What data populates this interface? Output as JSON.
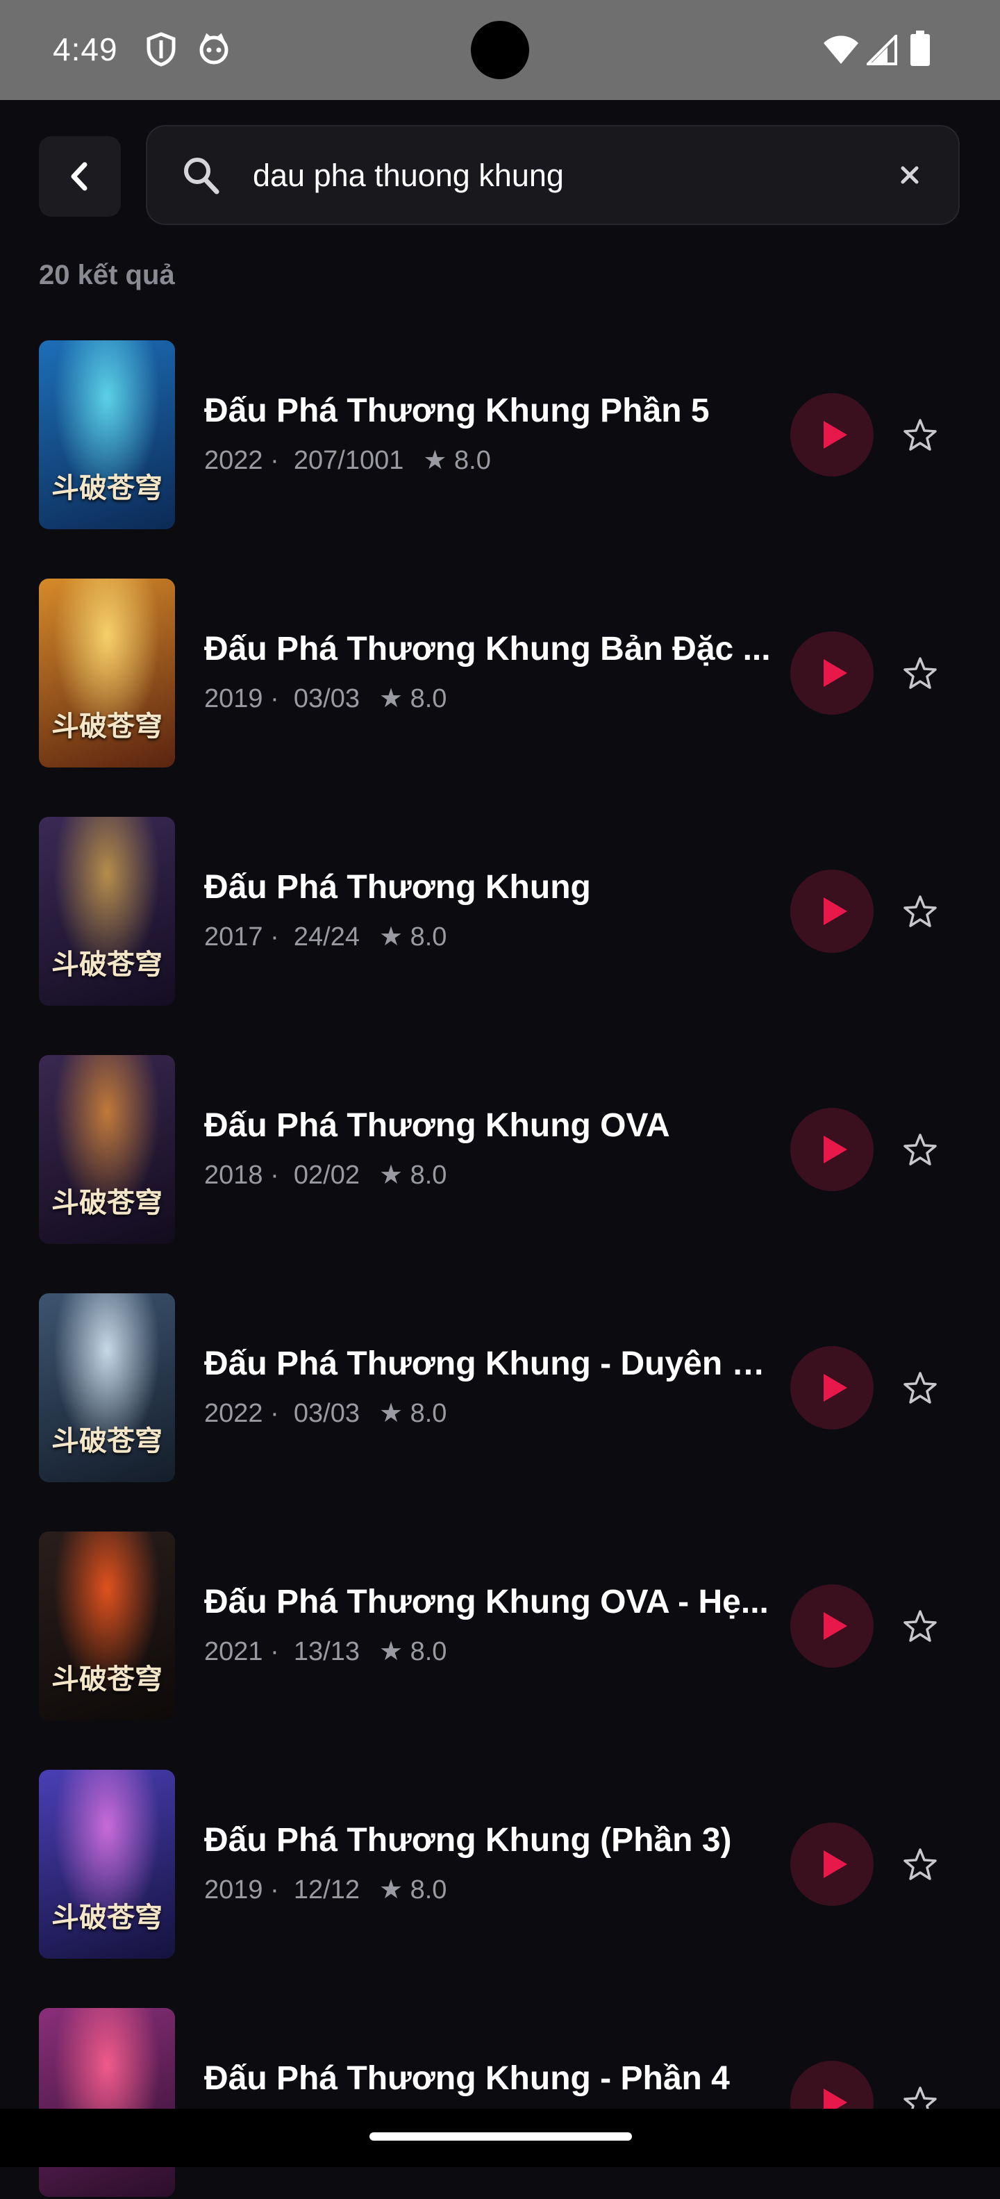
{
  "status_bar": {
    "time": "4:49"
  },
  "search": {
    "query": "dau pha thuong khung"
  },
  "results": {
    "count_label": "20 kết quả",
    "items": [
      {
        "title": "Đấu Phá Thương Khung Phần 5",
        "year": "2022 ·",
        "episodes": "207/1001",
        "rating": "★ 8.0",
        "palette": [
          "#1d6fb8",
          "#0c2a55",
          "#5bd1e8"
        ]
      },
      {
        "title": "Đấu Phá Thương Khung Bản Đặc ...",
        "year": "2019 ·",
        "episodes": "03/03",
        "rating": "★ 8.0",
        "palette": [
          "#d68a2a",
          "#5a2410",
          "#f6d06a"
        ]
      },
      {
        "title": "Đấu Phá Thương Khung",
        "year": "2017 ·",
        "episodes": "24/24",
        "rating": "★ 8.0",
        "palette": [
          "#3a2a55",
          "#140d22",
          "#b58d4a"
        ]
      },
      {
        "title": "Đấu Phá Thương Khung OVA",
        "year": "2018 ·",
        "episodes": "02/02",
        "rating": "★ 8.0",
        "palette": [
          "#3a2850",
          "#120c1e",
          "#c07a3a"
        ]
      },
      {
        "title": "Đấu Phá Thương Khung - Duyên K...",
        "year": "2022 ·",
        "episodes": "03/03",
        "rating": "★ 8.0",
        "palette": [
          "#3d5570",
          "#141d2a",
          "#c7d8e6"
        ]
      },
      {
        "title": "Đấu Phá Thương Khung OVA - Hẹ...",
        "year": "2021 ·",
        "episodes": "13/13",
        "rating": "★ 8.0",
        "palette": [
          "#2a1e1c",
          "#0d0a09",
          "#e0521e"
        ]
      },
      {
        "title": "Đấu Phá Thương Khung (Phần 3)",
        "year": "2019 ·",
        "episodes": "12/12",
        "rating": "★ 8.0",
        "palette": [
          "#4a3fb5",
          "#15123d",
          "#c86bd8"
        ]
      },
      {
        "title": "Đấu Phá Thương Khung - Phần 4",
        "year": "",
        "episodes": "",
        "rating": "",
        "palette": [
          "#8a2f7a",
          "#2a0e2a",
          "#f05a8a"
        ]
      }
    ]
  },
  "poster_text": "斗破苍穹",
  "colors": {
    "accent": "#e8194a",
    "background": "#0c0c10",
    "play_bg": "#3a0f1e"
  }
}
